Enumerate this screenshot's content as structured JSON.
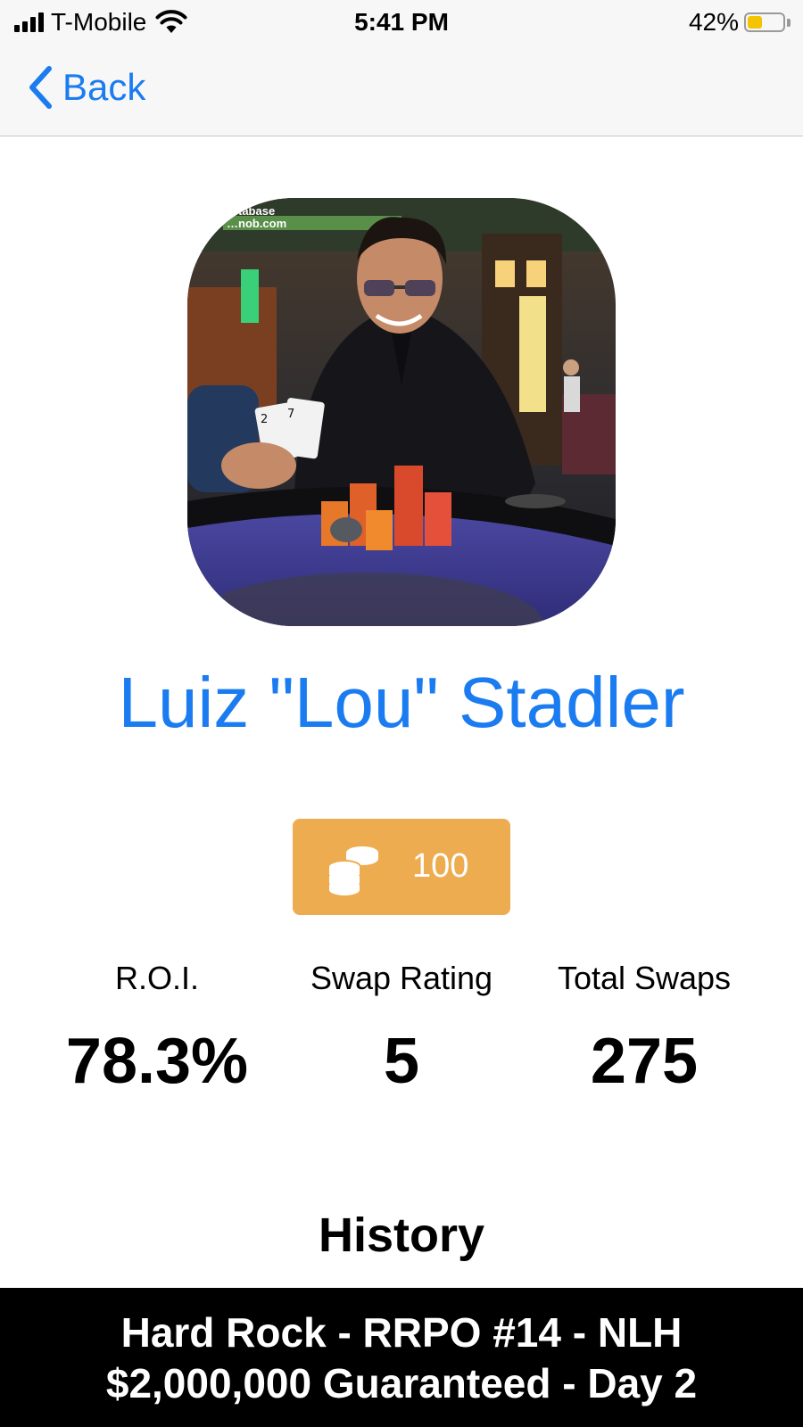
{
  "status_bar": {
    "carrier": "T-Mobile",
    "time": "5:41 PM",
    "battery_percent": "42%",
    "battery_level": 0.42,
    "battery_color": "#f5c400"
  },
  "nav": {
    "back_label": "Back",
    "back_icon": "chevron-left-icon",
    "accent_color": "#1a7cf0"
  },
  "profile": {
    "photo_watermark": "...tabase\n...nob.com",
    "name": "Luiz \"Lou\" Stadler",
    "coins": "100",
    "coins_icon": "coins-stack-icon",
    "coins_color": "#eeac51"
  },
  "stats": [
    {
      "label": "R.O.I.",
      "value": "78.3%"
    },
    {
      "label": "Swap Rating",
      "value": "5"
    },
    {
      "label": "Total Swaps",
      "value": "275"
    }
  ],
  "history": {
    "title": "History",
    "items": [
      {
        "title": "Hard Rock - RRPO #14 - NLH $2,000,000 Guaranteed - Day 2"
      }
    ]
  }
}
